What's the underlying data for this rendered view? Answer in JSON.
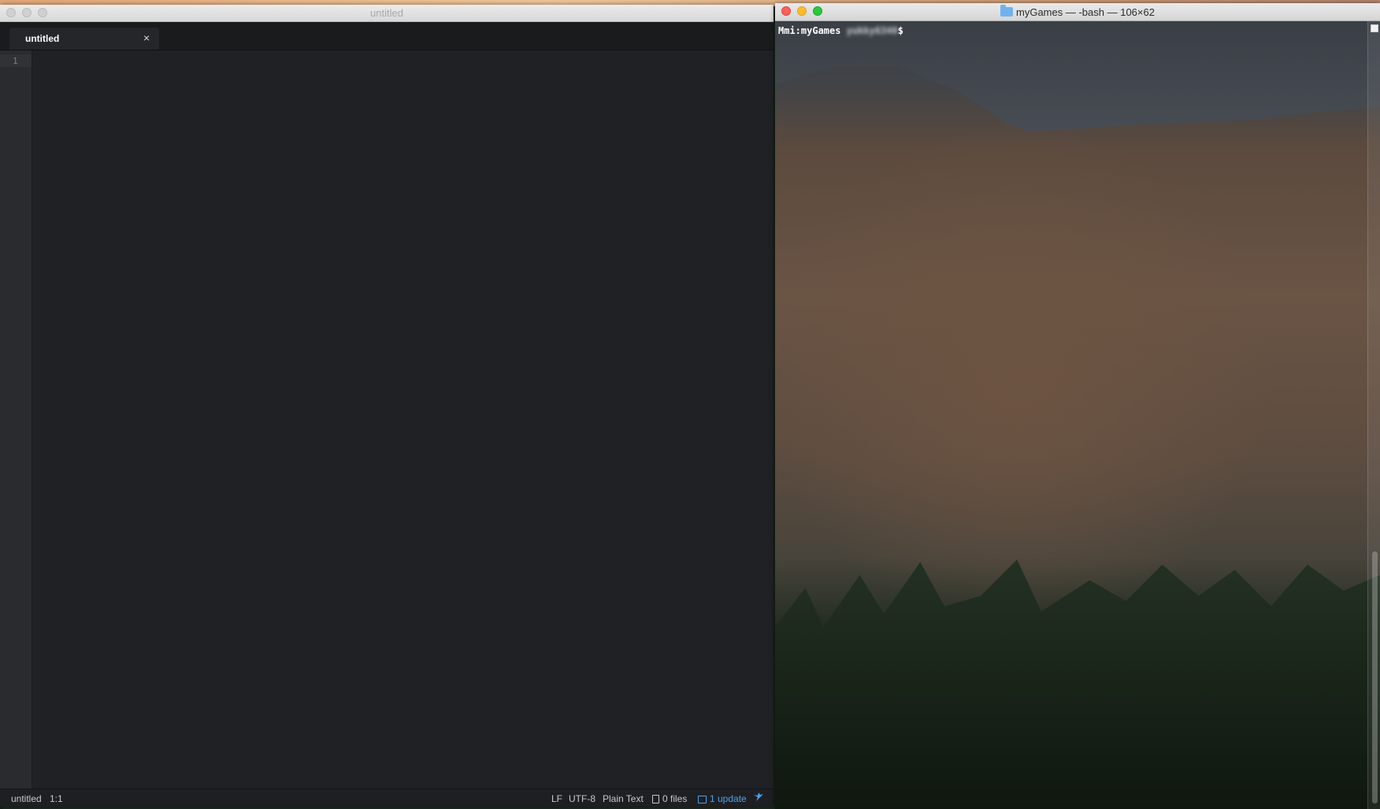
{
  "editor": {
    "window_title": "untitled",
    "tab_label": "untitled",
    "tab_close": "×",
    "line_number": "1",
    "status": {
      "filename": "untitled",
      "position": "1:1",
      "line_ending": "LF",
      "encoding": "UTF-8",
      "grammar": "Plain Text",
      "files": "0 files",
      "updates": "1 update"
    }
  },
  "terminal": {
    "window_title": "myGames — -bash — 106×62",
    "prompt_host": "Mmi:myGames ",
    "prompt_user": "yukky6340",
    "prompt_symbol": "$"
  },
  "colors": {
    "editor_bg": "#202124",
    "accent_blue": "#4aa3f0",
    "close_red": "#fc5f57",
    "min_yellow": "#fdbc2e",
    "max_green": "#28c840"
  }
}
